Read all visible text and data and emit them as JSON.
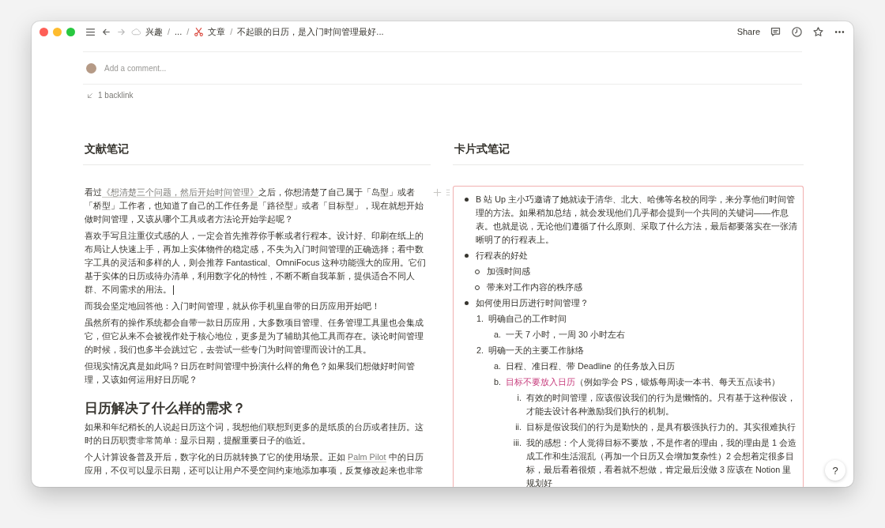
{
  "topbar": {
    "breadcrumbs": [
      {
        "kind": "icon_crumb",
        "label": "兴趣"
      },
      {
        "kind": "separator",
        "label": "/"
      },
      {
        "kind": "crumb",
        "label": "..."
      },
      {
        "kind": "separator",
        "label": "/"
      },
      {
        "kind": "icon_crumb",
        "label": "文章"
      },
      {
        "kind": "separator",
        "label": "/"
      },
      {
        "kind": "crumb",
        "label": "不起眼的日历，是入门时间管理最好..."
      }
    ],
    "share": "Share"
  },
  "comment": {
    "placeholder": "Add a comment..."
  },
  "backlinks": "1 backlink",
  "left": {
    "heading": "文献笔记",
    "blocks": [
      {
        "kind": "paragraph",
        "segments": [
          {
            "kind": "text",
            "text": "看过"
          },
          {
            "kind": "link",
            "text": "《想清楚三个问题，然后开始时间管理》"
          },
          {
            "kind": "text",
            "text": "之后，你想清楚了自己属于「岛型」或者「桥型」工作者，也知道了自己的工作任务是「路径型」或者「目标型」，现在就想开始做时间管理，又该从哪个工具或者方法论开始学起呢？"
          }
        ]
      },
      {
        "kind": "paragraph",
        "cursor": true,
        "segments": [
          {
            "kind": "text",
            "text": "喜欢手写且注重仪式感的人，一定会首先推荐你手帐或者行程本。设计好、印刷在纸上的布局让人快速上手，再加上实体物件的稳定感，不失为入门时间管理的正确选择；看中数字工具的灵活和多样的人，则会推荐 Fantastical、OmniFocus 这种功能强大的应用。它们基于实体的日历或待办清单，利用数字化的特性，不断不断自我革新，提供适合不同人群、不同需求的用法。"
          }
        ]
      },
      {
        "kind": "paragraph",
        "segments": [
          {
            "kind": "text",
            "text": "而我会坚定地回答他：入门时间管理，就从你手机里自带的日历应用开始吧！"
          }
        ]
      },
      {
        "kind": "paragraph",
        "segments": [
          {
            "kind": "text",
            "text": "虽然所有的操作系统都会自带一款日历应用，大多数项目管理、任务管理工具里也会集成它，但它从来不会被视作处于核心地位，更多是为了辅助其他工具而存在。谈论时间管理的时候，我们也多半会跳过它，去尝试一些专门为时间管理而设计的工具。"
          }
        ]
      },
      {
        "kind": "paragraph",
        "segments": [
          {
            "kind": "text",
            "text": "但现实情况真是如此吗？日历在时间管理中扮演什么样的角色？如果我们想做好时间管理，又该如何运用好日历呢？"
          }
        ]
      },
      {
        "kind": "heading",
        "segments": [
          {
            "kind": "text",
            "text": "日历解决了什么样的需求？"
          }
        ]
      },
      {
        "kind": "paragraph",
        "segments": [
          {
            "kind": "text",
            "text": "如果和年纪稍长的人说起日历这个词，我想他们联想到更多的是纸质的台历或者挂历。这时的日历职责非常简单：显示日期，提醒重要日子的临近。"
          }
        ]
      },
      {
        "kind": "paragraph",
        "segments": [
          {
            "kind": "text",
            "text": "个人计算设备普及开后，数字化的日历就转换了它的使用场景。正如 "
          },
          {
            "kind": "link",
            "text": "Palm Pilot"
          },
          {
            "kind": "text",
            "text": " 中的日历应用，不仅可以显示日期，还可以让用户不受空间约束地添加事项，反复修改起来也非常"
          }
        ]
      }
    ]
  },
  "right": {
    "heading": "卡片式笔记",
    "items": [
      {
        "segments": [
          {
            "kind": "text",
            "text": "B 站 Up 主小巧邀请了她就读于清华、北大、哈佛等名校的同学，来分享他们时间管理的方法。如果稍加总结，就会发现他们几乎都会提到一个共同的关键词——作息表。也就是说，无论他们遵循了什么原则、采取了什么方法，最后都要落实在一张清晰明了的行程表上。"
          }
        ]
      },
      {
        "segments": [
          {
            "kind": "text",
            "text": "行程表的好处"
          }
        ],
        "children": [
          {
            "segments": [
              {
                "kind": "text",
                "text": "加强时间感"
              }
            ]
          },
          {
            "segments": [
              {
                "kind": "text",
                "text": "带来对工作内容的秩序感"
              }
            ]
          }
        ]
      },
      {
        "segments": [
          {
            "kind": "text",
            "text": "如何使用日历进行时间管理？"
          }
        ],
        "children": [
          {
            "marker": "1.",
            "segments": [
              {
                "kind": "text",
                "text": "明确自己的工作时间"
              }
            ],
            "children": [
              {
                "marker": "a.",
                "segments": [
                  {
                    "kind": "text",
                    "text": "一天 7 小时，一周 30 小时左右"
                  }
                ]
              }
            ]
          },
          {
            "marker": "2.",
            "segments": [
              {
                "kind": "text",
                "text": "明确一天的主要工作脉络"
              }
            ],
            "children": [
              {
                "marker": "a.",
                "segments": [
                  {
                    "kind": "text",
                    "text": "日程、准日程、带 Deadline 的任务放入日历"
                  }
                ]
              },
              {
                "marker": "b.",
                "segments": [
                  {
                    "kind": "accent",
                    "text": "目标不要放入日历"
                  },
                  {
                    "kind": "text",
                    "text": "（例如学会 PS，锻炼每周读一本书、每天五点读书）"
                  }
                ],
                "children": [
                  {
                    "marker": "i.",
                    "segments": [
                      {
                        "kind": "text",
                        "text": "有效的时间管理，应该假设我们的行为是懒惰的。只有基于这种假设，才能去设计各种激励我们执行的机制。"
                      }
                    ]
                  },
                  {
                    "marker": "ii.",
                    "segments": [
                      {
                        "kind": "text",
                        "text": "目标是假设我们的行为是勤快的，是具有极强执行力的。其实很难执行"
                      }
                    ]
                  },
                  {
                    "marker": "iii.",
                    "segments": [
                      {
                        "kind": "text",
                        "text": "我的感想：个人觉得目标不要放，不是作者的理由，我的理由是 1 会造成工作和生活混乱（再加一个日历又会增加复杂性）2 会想着定很多目标，最后看着很烦，看着就不想做，肯定最后没做 3 应该在 Notion 里规划好"
                      }
                    ]
                  }
                ]
              }
            ]
          }
        ]
      }
    ]
  },
  "help": "?"
}
